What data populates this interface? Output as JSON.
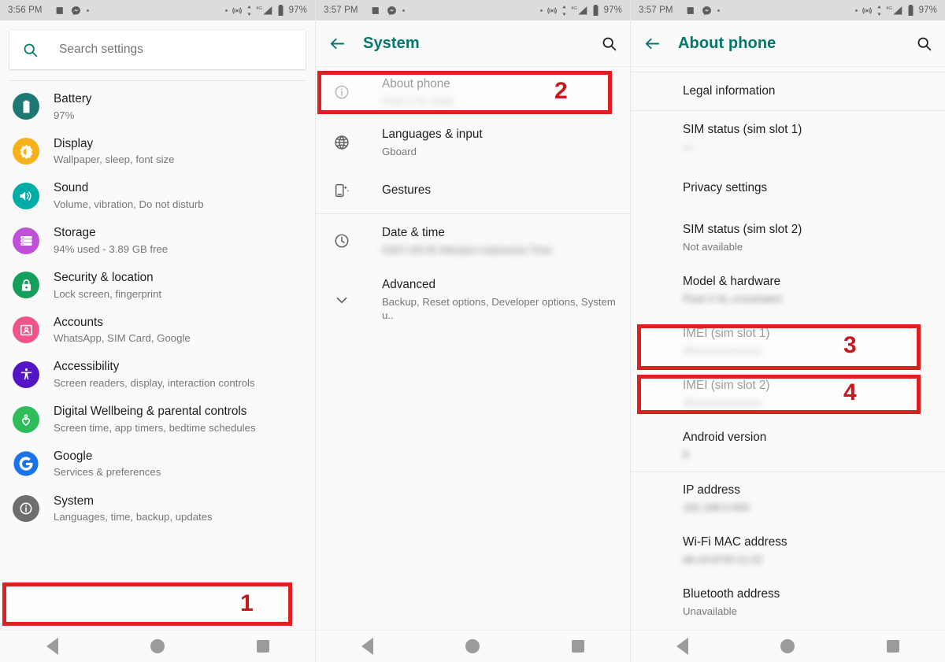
{
  "colors": {
    "accent_teal": "#00786a",
    "annotation_red": "#e02020",
    "annotation_number_red": "#c31b1b",
    "statusbar_bg": "#dcdcdc",
    "page_bg": "#fafafa",
    "title_text": "#1f1f1f",
    "subtitle_text": "#777777",
    "nav_icon": "#9b9b9b"
  },
  "panels": [
    {
      "id": "settings-home",
      "statusbar": {
        "time": "3:56 PM",
        "battery_percent": "97%",
        "left_icons": [
          "news-icon",
          "messenger-icon",
          "dot-icon"
        ],
        "right_icons": [
          "dot-icon",
          "hotspot-icon",
          "data-transfer-icon",
          "signal-4g-icon",
          "battery-icon"
        ]
      },
      "search": {
        "placeholder": "Search settings",
        "value": "",
        "icon": "search-icon"
      },
      "items": [
        {
          "title": "Battery",
          "sub": "97%",
          "icon": "battery-icon",
          "color": "#1d7874"
        },
        {
          "title": "Display",
          "sub": "Wallpaper, sleep, font size",
          "icon": "brightness-icon",
          "color": "#f7b11a"
        },
        {
          "title": "Sound",
          "sub": "Volume, vibration, Do not disturb",
          "icon": "volume-icon",
          "color": "#00aca6"
        },
        {
          "title": "Storage",
          "sub": "94% used - 3.89 GB free",
          "icon": "storage-icon",
          "color": "#c050d8"
        },
        {
          "title": "Security & location",
          "sub": "Lock screen, fingerprint",
          "icon": "lock-icon",
          "color": "#14a05a"
        },
        {
          "title": "Accounts",
          "sub": "WhatsApp, SIM Card, Google",
          "icon": "account-icon",
          "color": "#f0548a"
        },
        {
          "title": "Accessibility",
          "sub": "Screen readers, display, interaction controls",
          "icon": "accessibility-icon",
          "color": "#5416c4"
        },
        {
          "title": "Digital Wellbeing & parental controls",
          "sub": "Screen time, app timers, bedtime schedules",
          "icon": "wellbeing-icon",
          "color": "#2dbd5b"
        },
        {
          "title": "Google",
          "sub": "Services & preferences",
          "icon": "google-g-icon",
          "color": "#1a73e8"
        },
        {
          "title": "System",
          "sub": "Languages, time, backup, updates",
          "icon": "info-circle-icon",
          "color": "#6e6e6e"
        }
      ],
      "annotation": {
        "number": "1",
        "target": "System"
      }
    },
    {
      "id": "system",
      "statusbar": {
        "time": "3:57 PM",
        "battery_percent": "97%",
        "left_icons": [
          "news-icon",
          "messenger-icon",
          "dot-icon"
        ],
        "right_icons": [
          "dot-icon",
          "hotspot-icon",
          "data-transfer-icon",
          "signal-4g-icon",
          "battery-icon"
        ]
      },
      "appbar": {
        "title": "System",
        "back_icon": "back-arrow-icon",
        "search_icon": "search-icon"
      },
      "items": [
        {
          "title": "About phone",
          "sub": "",
          "sub_redacted": true,
          "icon": "info-circle-outline-icon"
        },
        {
          "title": "Languages & input",
          "sub": "Gboard",
          "sub_redacted": false,
          "icon": "globe-icon"
        },
        {
          "title": "Gestures",
          "sub": "",
          "sub_redacted": false,
          "icon": "gestures-icon"
        },
        {
          "title": "Date & time",
          "sub": "",
          "sub_redacted": true,
          "icon": "clock-icon"
        },
        {
          "title": "Advanced",
          "sub": "Backup, Reset options, Developer options, System u..",
          "sub_redacted": false,
          "icon": "chevron-down-icon"
        }
      ],
      "annotation": {
        "number": "2",
        "target": "About phone"
      }
    },
    {
      "id": "about-phone",
      "statusbar": {
        "time": "3:57 PM",
        "battery_percent": "97%",
        "left_icons": [
          "news-icon",
          "messenger-icon",
          "dot-icon"
        ],
        "right_icons": [
          "dot-icon",
          "hotspot-icon",
          "data-transfer-icon",
          "signal-4g-icon",
          "battery-icon"
        ]
      },
      "appbar": {
        "title": "About phone",
        "back_icon": "back-arrow-icon",
        "search_icon": "search-icon"
      },
      "items": [
        {
          "title": "Legal information",
          "sub": "",
          "sub_redacted": false
        },
        {
          "title": "SIM status (sim slot 1)",
          "sub": "",
          "sub_redacted": true
        },
        {
          "title": "Privacy settings",
          "sub": "",
          "sub_redacted": false
        },
        {
          "title": "SIM status (sim slot 2)",
          "sub": "Not available",
          "sub_redacted": false
        },
        {
          "title": "Model & hardware",
          "sub": "",
          "sub_redacted": true
        },
        {
          "title": "IMEI (sim slot 1)",
          "sub": "",
          "sub_redacted": true
        },
        {
          "title": "IMEI (sim slot 2)",
          "sub": "",
          "sub_redacted": true
        },
        {
          "title": "Android version",
          "sub": "",
          "sub_redacted": true
        },
        {
          "title": "IP address",
          "sub": "",
          "sub_redacted": true
        },
        {
          "title": "Wi-Fi MAC address",
          "sub": "",
          "sub_redacted": true
        },
        {
          "title": "Bluetooth address",
          "sub": "Unavailable",
          "sub_redacted": false
        }
      ],
      "annotations": [
        {
          "number": "3",
          "target": "IMEI (sim slot 1)"
        },
        {
          "number": "4",
          "target": "IMEI (sim slot 2)"
        }
      ]
    }
  ],
  "navbar": {
    "back": "back-triangle-icon",
    "home": "home-circle-icon",
    "recents": "recents-square-icon"
  }
}
